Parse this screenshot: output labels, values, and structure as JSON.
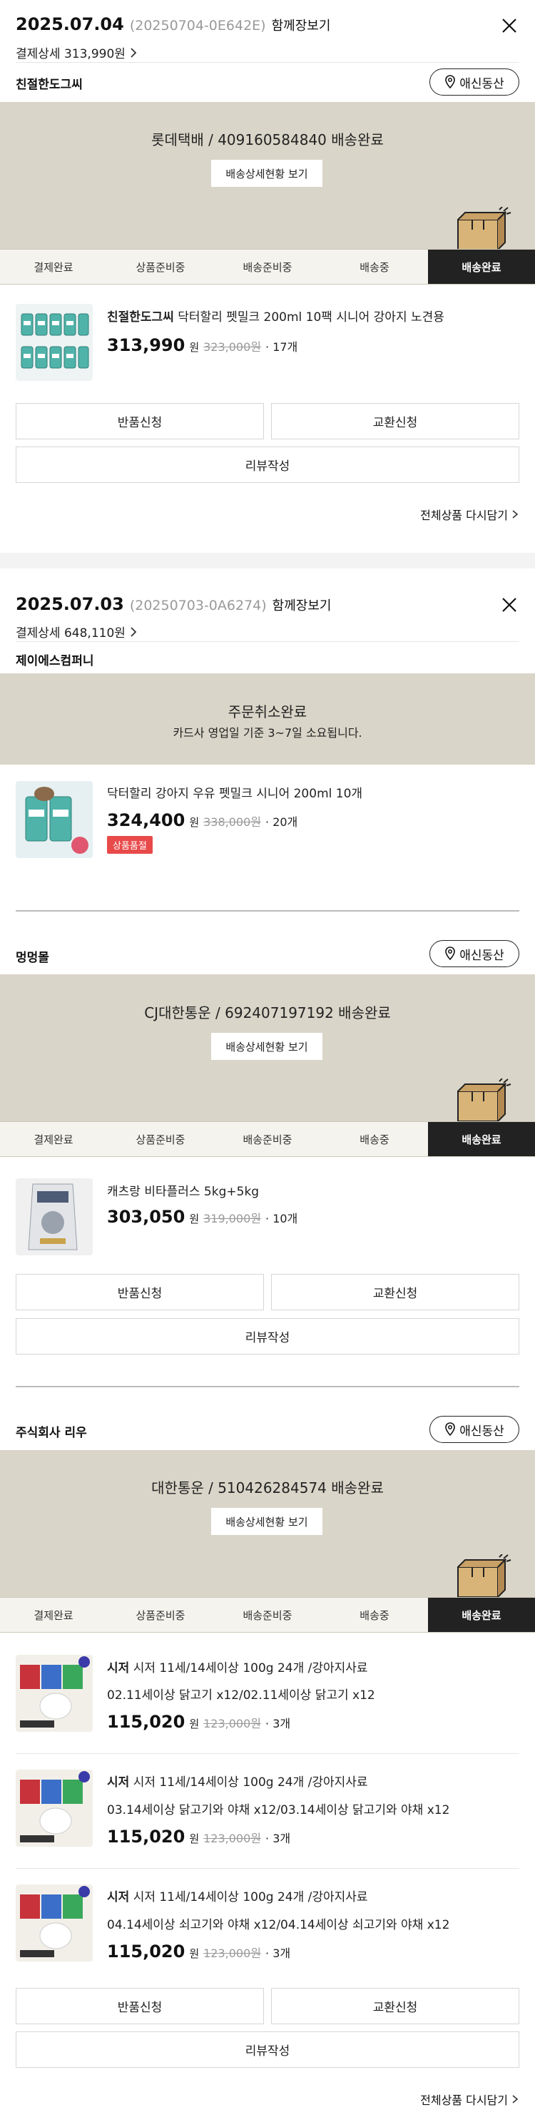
{
  "orders": [
    {
      "date": "2025.07.04",
      "order_no": "(20250704-0E642E)",
      "view_together": "함께장보기",
      "payment_detail": "결제상세 313,990원",
      "shipments": [
        {
          "seller": "친절한도그씨",
          "location": "애신동산",
          "carrier_status": "롯데택배 / 409160584840 배송완료",
          "tracking_button": "배송상세현황 보기",
          "steps": [
            "결제완료",
            "상품준비중",
            "배송준비중",
            "배송중",
            "배송완료"
          ],
          "active_step": 4,
          "items": [
            {
              "brand": "친절한도그씨",
              "name": "닥터할리 펫밀크 200ml 10팩 시니어 강아지 노견용",
              "price": "313,990",
              "won": "원",
              "orig_price": "323,000원",
              "qty": "· 17개"
            }
          ],
          "buttons": {
            "return": "반품신청",
            "exchange": "교환신청",
            "review": "리뷰작성"
          },
          "reorder": "전체상품 다시담기"
        }
      ]
    },
    {
      "date": "2025.07.03",
      "order_no": "(20250703-0A6274)",
      "view_together": "함께장보기",
      "payment_detail": "결제상세 648,110원",
      "shipments": [
        {
          "seller": "제이에스컴퍼니",
          "cancel_title": "주문취소완료",
          "cancel_note": "카드사 영업일 기준 3~7일 소요됩니다.",
          "items": [
            {
              "brand": "",
              "name": "닥터할리 강아지 우유 펫밀크 시니어 200ml 10개",
              "price": "324,400",
              "won": "원",
              "orig_price": "338,000원",
              "qty": "· 20개",
              "badge": "상품품절"
            }
          ]
        },
        {
          "seller": "멍멍몰",
          "location": "애신동산",
          "carrier_status": "CJ대한통운 / 692407197192 배송완료",
          "tracking_button": "배송상세현황 보기",
          "steps": [
            "결제완료",
            "상품준비중",
            "배송준비중",
            "배송중",
            "배송완료"
          ],
          "active_step": 4,
          "items": [
            {
              "brand": "",
              "name": "캐츠랑 비타플러스 5kg+5kg",
              "price": "303,050",
              "won": "원",
              "orig_price": "319,000원",
              "qty": "· 10개"
            }
          ],
          "buttons": {
            "return": "반품신청",
            "exchange": "교환신청",
            "review": "리뷰작성"
          }
        },
        {
          "seller": "주식회사 리우",
          "location": "애신동산",
          "carrier_status": "대한통운 / 510426284574 배송완료",
          "tracking_button": "배송상세현황 보기",
          "steps": [
            "결제완료",
            "상품준비중",
            "배송준비중",
            "배송중",
            "배송완료"
          ],
          "active_step": 4,
          "items": [
            {
              "brand": "시저",
              "name": "시저 11세/14세이상 100g 24개 /강아지사료",
              "option": "02.11세이상 닭고기 x12/02.11세이상 닭고기 x12",
              "price": "115,020",
              "won": "원",
              "orig_price": "123,000원",
              "qty": "· 3개"
            },
            {
              "brand": "시저",
              "name": "시저 11세/14세이상 100g 24개 /강아지사료",
              "option": "03.14세이상 닭고기와 야채 x12/03.14세이상 닭고기와 야채 x12",
              "price": "115,020",
              "won": "원",
              "orig_price": "123,000원",
              "qty": "· 3개"
            },
            {
              "brand": "시저",
              "name": "시저 11세/14세이상 100g 24개 /강아지사료",
              "option": "04.14세이상 쇠고기와 야채 x12/04.14세이상 쇠고기와 야채 x12",
              "price": "115,020",
              "won": "원",
              "orig_price": "123,000원",
              "qty": "· 3개"
            }
          ],
          "buttons": {
            "return": "반품신청",
            "exchange": "교환신청",
            "review": "리뷰작성"
          },
          "reorder": "전체상품 다시담기"
        }
      ]
    }
  ],
  "colors": {
    "beige": "#d9d5c8",
    "active_step": "#222222",
    "soldout": "#e84a4a"
  },
  "icons": [
    "close-icon",
    "location-pin-icon",
    "chevron-right-icon",
    "delivery-box-icon"
  ]
}
